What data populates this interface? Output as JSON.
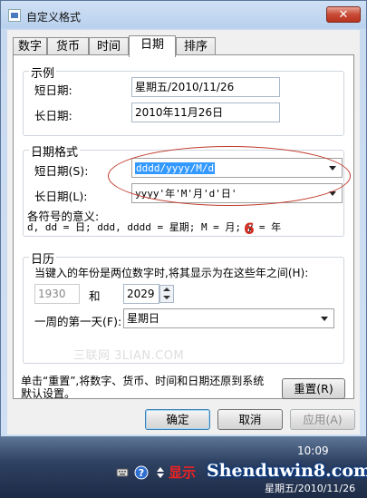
{
  "window": {
    "title": "自定义格式",
    "close_label": "✕"
  },
  "tabs": [
    {
      "label": "数字"
    },
    {
      "label": "货币"
    },
    {
      "label": "时间"
    },
    {
      "label": "日期",
      "active": true
    },
    {
      "label": "排序"
    }
  ],
  "example": {
    "group_title": "示例",
    "short_label": "短日期:",
    "short_value": "星期五/2010/11/26",
    "long_label": "长日期:",
    "long_value": "2010年11月26日"
  },
  "format": {
    "group_title": "日期格式",
    "short_label": "短日期(S):",
    "short_value": "dddd/yyyy/M/d",
    "long_label": "长日期(L):",
    "long_value": "yyyy'年'M'月'd'日'",
    "meaning_title": "各符号的意义:",
    "meaning_line": "d, dd = 日;  ddd, dddd = 星期;  M = 月;  y = 年"
  },
  "annotation_number": "6",
  "calendar": {
    "group_title": "日历",
    "two_digit_label": "当键入的年份是两位数字时,将其显示为在这些年之间(H):",
    "year_from": "1930",
    "and_label": "和",
    "year_to": "2029",
    "first_day_label": "一周的第一天(F):",
    "first_day_value": "星期日"
  },
  "watermark": "三联网 3LIAN.COM",
  "reset": {
    "description": "单击“重置”,将数字、货币、时间和日期还原到系统默认设置。",
    "button_label": "重置(R)"
  },
  "buttons": {
    "ok": "确定",
    "cancel": "取消",
    "apply": "应用(A)"
  },
  "taskbar": {
    "red_text": "显示",
    "brand": "Shenduwin8.com",
    "time": "10:09",
    "date": "星期五/2010/11/26"
  }
}
